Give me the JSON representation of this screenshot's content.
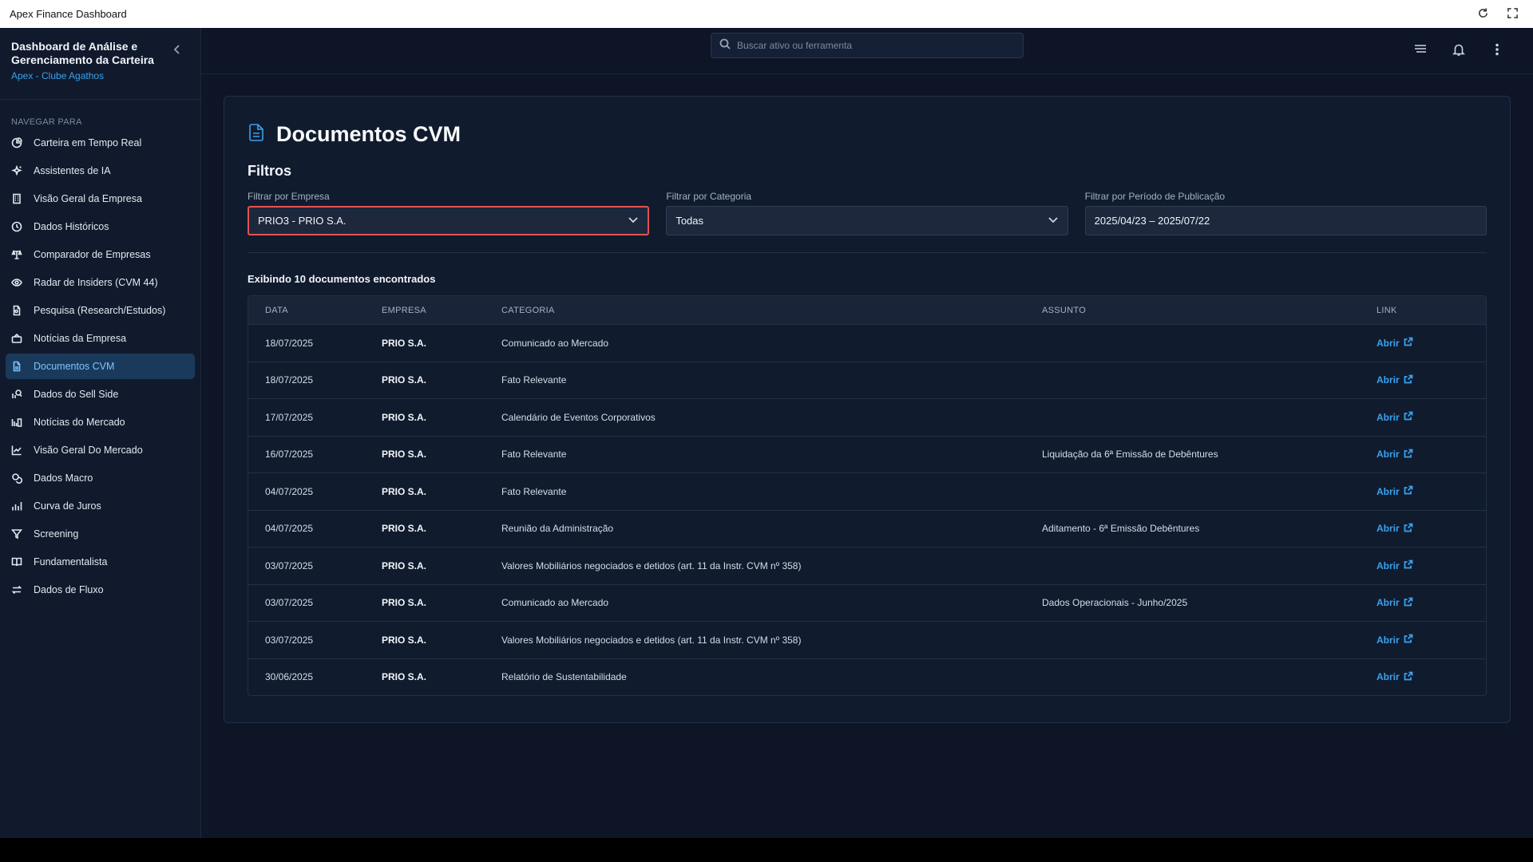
{
  "window": {
    "title": "Apex Finance Dashboard"
  },
  "sidebar": {
    "title": "Dashboard de Análise e Gerenciamento da Carteira",
    "subtitle": "Apex - Clube Agathos",
    "nav_label": "NAVEGAR PARA",
    "items": [
      {
        "label": "Carteira em Tempo Real",
        "icon": "pie-chart-icon"
      },
      {
        "label": "Assistentes de IA",
        "icon": "sparkles-icon"
      },
      {
        "label": "Visão Geral da Empresa",
        "icon": "building-icon"
      },
      {
        "label": "Dados Históricos",
        "icon": "clock-icon"
      },
      {
        "label": "Comparador de Empresas",
        "icon": "scale-icon"
      },
      {
        "label": "Radar de Insiders (CVM 44)",
        "icon": "eye-icon"
      },
      {
        "label": "Pesquisa (Research/Estudos)",
        "icon": "document-search-icon"
      },
      {
        "label": "Notícias da Empresa",
        "icon": "newspaper-icon"
      },
      {
        "label": "Documentos CVM",
        "icon": "file-text-icon",
        "active": true
      },
      {
        "label": "Dados do Sell Side",
        "icon": "search-chart-icon"
      },
      {
        "label": "Notícias do Mercado",
        "icon": "news-icon"
      },
      {
        "label": "Visão Geral Do Mercado",
        "icon": "line-chart-icon"
      },
      {
        "label": "Dados Macro",
        "icon": "coins-icon"
      },
      {
        "label": "Curva de Juros",
        "icon": "bar-chart-icon"
      },
      {
        "label": "Screening",
        "icon": "filter-icon"
      },
      {
        "label": "Fundamentalista",
        "icon": "book-icon"
      },
      {
        "label": "Dados de Fluxo",
        "icon": "arrows-icon"
      }
    ]
  },
  "search": {
    "placeholder": "Buscar ativo ou ferramenta"
  },
  "page": {
    "title": "Documentos CVM",
    "filters_heading": "Filtros",
    "filters": {
      "empresa": {
        "label": "Filtrar por Empresa",
        "value": "PRIO3 - PRIO S.A."
      },
      "categoria": {
        "label": "Filtrar por Categoria",
        "value": "Todas"
      },
      "periodo": {
        "label": "Filtrar por Período de Publicação",
        "value": "2025/04/23 – 2025/07/22"
      }
    },
    "results_text": "Exibindo 10 documentos encontrados",
    "table": {
      "headers": {
        "data": "DATA",
        "empresa": "EMPRESA",
        "categoria": "CATEGORIA",
        "assunto": "ASSUNTO",
        "link": "LINK"
      },
      "link_label": "Abrir",
      "rows": [
        {
          "data": "18/07/2025",
          "empresa": "PRIO S.A.",
          "categoria": "Comunicado ao Mercado",
          "assunto": ""
        },
        {
          "data": "18/07/2025",
          "empresa": "PRIO S.A.",
          "categoria": "Fato Relevante",
          "assunto": ""
        },
        {
          "data": "17/07/2025",
          "empresa": "PRIO S.A.",
          "categoria": "Calendário de Eventos Corporativos",
          "assunto": ""
        },
        {
          "data": "16/07/2025",
          "empresa": "PRIO S.A.",
          "categoria": "Fato Relevante",
          "assunto": "Liquidação da 6ª Emissão de Debêntures"
        },
        {
          "data": "04/07/2025",
          "empresa": "PRIO S.A.",
          "categoria": "Fato Relevante",
          "assunto": ""
        },
        {
          "data": "04/07/2025",
          "empresa": "PRIO S.A.",
          "categoria": "Reunião da Administração",
          "assunto": "Aditamento - 6ª Emissão Debêntures"
        },
        {
          "data": "03/07/2025",
          "empresa": "PRIO S.A.",
          "categoria": "Valores Mobiliários negociados e detidos (art. 11 da Instr. CVM nº 358)",
          "assunto": ""
        },
        {
          "data": "03/07/2025",
          "empresa": "PRIO S.A.",
          "categoria": "Comunicado ao Mercado",
          "assunto": "Dados Operacionais - Junho/2025"
        },
        {
          "data": "03/07/2025",
          "empresa": "PRIO S.A.",
          "categoria": "Valores Mobiliários negociados e detidos (art. 11 da Instr. CVM nº 358)",
          "assunto": ""
        },
        {
          "data": "30/06/2025",
          "empresa": "PRIO S.A.",
          "categoria": "Relatório de Sustentabilidade",
          "assunto": ""
        }
      ]
    }
  },
  "colors": {
    "accent": "#38a3ee",
    "error_border": "#e25353",
    "background": "#0d1526",
    "sidebar_active": "#1a3a5c"
  }
}
